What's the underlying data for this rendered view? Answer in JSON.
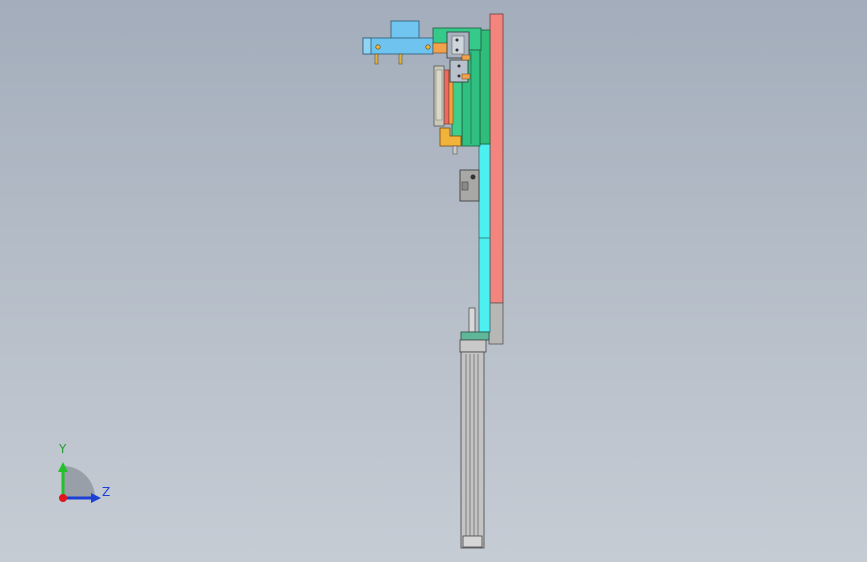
{
  "viewport": {
    "model": "cad-assembly-side-view",
    "colors": {
      "background_top": "#a3adbb",
      "background_bottom": "#c6ccd4",
      "back_plate": "#f4857e",
      "guide_rail": "#4df0f0",
      "carriage": "#2fc888",
      "clamp_block": "#6ec8ee",
      "bracket": "#f2b33a",
      "gray_part": "#b4b4b4",
      "cylinder_body": "#c4c4c4"
    }
  },
  "triad": {
    "y_label": "Y",
    "z_label": "Z",
    "y_color": "#22c02a",
    "z_color": "#1c3fd6",
    "x_color": "#e0161b"
  }
}
